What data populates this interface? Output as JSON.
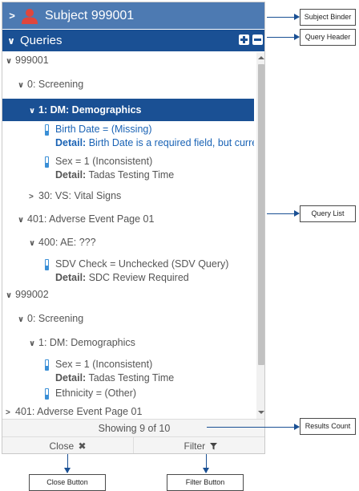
{
  "subject_bar": {
    "chevron": "›",
    "icon": "user-icon",
    "title": "Subject 999001"
  },
  "queries_bar": {
    "title": "Queries",
    "expand_icon": "plus-box-icon",
    "collapse_icon": "minus-box-icon"
  },
  "tree": {
    "subject1": "999001",
    "screening1": "0: Screening",
    "demographics1": "1: DM: Demographics",
    "q1_line1": "Birth Date = (Missing)",
    "q1_detail_label": "Detail:",
    "q1_detail": "Birth Date is a required field, but curren…",
    "q2_line1": "Sex = 1 (Inconsistent)",
    "q2_detail_label": "Detail:",
    "q2_detail": "Tadas Testing Time",
    "vitals1": "30: VS: Vital Signs",
    "ae_page1": "401: Adverse Event Page 01",
    "ae1": "400: AE: ???",
    "q3_line1": "SDV Check = Unchecked (SDV Query)",
    "q3_detail_label": "Detail:",
    "q3_detail": "SDC Review Required",
    "subject2": "999002",
    "screening2": "0: Screening",
    "demographics2": "1: DM: Demographics",
    "q4_line1": "Sex = 1 (Inconsistent)",
    "q4_detail_label": "Detail:",
    "q4_detail": "Tadas Testing Time",
    "q5_line1": "Ethnicity = (Other)",
    "ae_page2": "401: Adverse Event Page 01"
  },
  "footer": {
    "results": "Showing 9 of 10",
    "close_label": "Close",
    "close_icon": "x-icon",
    "filter_label": "Filter",
    "filter_icon": "funnel-icon"
  },
  "callouts": {
    "subject_binder": "Subject Binder",
    "query_header": "Query Header",
    "query_list": "Query List",
    "results_count": "Results Count",
    "close_button": "Close Button",
    "filter_button": "Filter Button"
  },
  "colors": {
    "subject_bar": "#4d7ab2",
    "queries_bar": "#1a5094",
    "selected_row": "#1a5094",
    "query_indicator": "#3a8fd6",
    "user_icon": "#e0463c",
    "callout_arrow": "#1a5094"
  }
}
